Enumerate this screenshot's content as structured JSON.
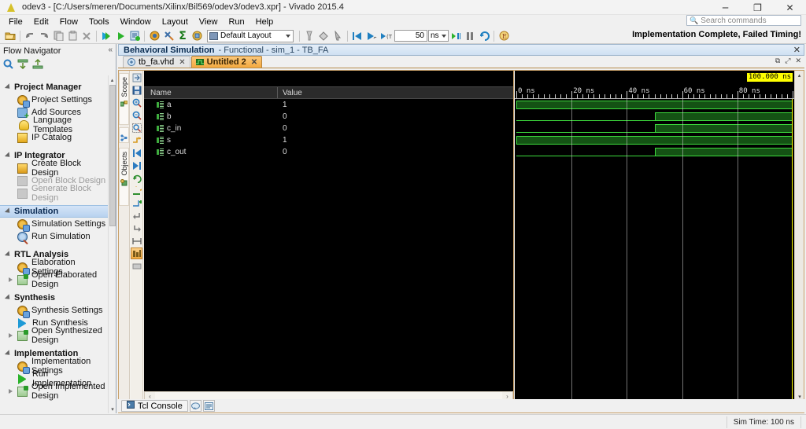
{
  "window": {
    "title": "odev3 - [C:/Users/meren/Documents/Xilinx/Bil569/odev3/odev3.xpr] - Vivado 2015.4",
    "app_icon": "vivado-triangle-icon",
    "minimize": "─",
    "maximize": "❐",
    "close": "✕"
  },
  "menubar": {
    "items": [
      {
        "label": "File"
      },
      {
        "label": "Edit"
      },
      {
        "label": "Flow"
      },
      {
        "label": "Tools"
      },
      {
        "label": "Window"
      },
      {
        "label": "Layout"
      },
      {
        "label": "View"
      },
      {
        "label": "Run"
      },
      {
        "label": "Help"
      }
    ]
  },
  "search": {
    "placeholder": "Search commands",
    "icon": "search-icon"
  },
  "toolbar": {
    "layout_value": "Default Layout",
    "sim_time_value": "50",
    "sim_time_unit": "ns",
    "status_message": "Implementation Complete, Failed Timing!",
    "buttons": [
      "open-project-icon",
      "undo-icon",
      "redo-icon",
      "copy-icon",
      "paste-icon",
      "delete-icon",
      "run-synthesis-icon",
      "run-implementation-icon",
      "generate-bitstream-icon",
      "language-templates-icon",
      "settings-icon",
      "report-icon",
      "ip-catalog-icon"
    ],
    "right_buttons": [
      "mark-icon",
      "drc-icon",
      "pointer-icon",
      "restart-sim-icon",
      "run-all-icon",
      "run-for-icon",
      "step-icon",
      "pause-icon",
      "relaunch-icon",
      "break-icon"
    ]
  },
  "flow_navigator": {
    "title": "Flow Navigator",
    "collapse_icon": "collapse-left-icon",
    "tools": [
      "search-icon",
      "collapse-all-icon",
      "expand-all-icon"
    ],
    "sections": [
      {
        "label": "Project Manager",
        "selected": false,
        "items": [
          {
            "label": "Project Settings",
            "icon": "gear-icon",
            "dim": false,
            "expandable": false
          },
          {
            "label": "Add Sources",
            "icon": "add-sources-icon",
            "dim": false,
            "expandable": false
          },
          {
            "label": "Language Templates",
            "icon": "bulb-icon",
            "dim": false,
            "expandable": false
          },
          {
            "label": "IP Catalog",
            "icon": "ip-catalog-icon",
            "dim": false,
            "expandable": false
          }
        ]
      },
      {
        "label": "IP Integrator",
        "selected": false,
        "items": [
          {
            "label": "Create Block Design",
            "icon": "block-design-icon",
            "dim": false,
            "expandable": false
          },
          {
            "label": "Open Block Design",
            "icon": "block-dim-icon",
            "dim": true,
            "expandable": false
          },
          {
            "label": "Generate Block Design",
            "icon": "block-dim-icon",
            "dim": true,
            "expandable": false
          }
        ]
      },
      {
        "label": "Simulation",
        "selected": true,
        "items": [
          {
            "label": "Simulation Settings",
            "icon": "gear-icon",
            "dim": false,
            "expandable": false
          },
          {
            "label": "Run Simulation",
            "icon": "run-sim-icon",
            "dim": false,
            "expandable": false
          }
        ]
      },
      {
        "label": "RTL Analysis",
        "selected": false,
        "items": [
          {
            "label": "Elaboration Settings",
            "icon": "gear-icon",
            "dim": false,
            "expandable": false
          },
          {
            "label": "Open Elaborated Design",
            "icon": "open-design-icon",
            "dim": false,
            "expandable": true
          }
        ]
      },
      {
        "label": "Synthesis",
        "selected": false,
        "items": [
          {
            "label": "Synthesis Settings",
            "icon": "gear-icon",
            "dim": false,
            "expandable": false
          },
          {
            "label": "Run Synthesis",
            "icon": "run-green-icon",
            "dim": false,
            "expandable": false
          },
          {
            "label": "Open Synthesized Design",
            "icon": "open-design-icon",
            "dim": false,
            "expandable": true
          }
        ]
      },
      {
        "label": "Implementation",
        "selected": false,
        "items": [
          {
            "label": "Implementation Settings",
            "icon": "gear-icon",
            "dim": false,
            "expandable": false
          },
          {
            "label": "Run Implementation",
            "icon": "run-green-icon",
            "dim": false,
            "expandable": false
          },
          {
            "label": "Open Implemented Design",
            "icon": "open-design-icon",
            "dim": false,
            "expandable": true
          }
        ]
      }
    ]
  },
  "sim_panel": {
    "header_bold": "Behavioral Simulation",
    "header_sub": "- Functional - sim_1 - TB_FA",
    "header_close": "✕",
    "tabs": [
      {
        "label": "tb_fa.vhd",
        "icon": "vhdl-file-icon",
        "active": false,
        "close": "✕"
      },
      {
        "label": "Untitled 2",
        "icon": "waveform-icon",
        "active": true,
        "close": "✕"
      }
    ],
    "window_buttons": [
      "float-icon",
      "maximize-icon",
      "close-icon"
    ],
    "vertical_tabs": [
      {
        "label": "Scope",
        "icon": "scope-icon"
      },
      {
        "label": "Objects",
        "icon": "objects-icon"
      }
    ],
    "wave_toolbar": [
      "add-divider-icon",
      "save-waveform-icon",
      "zoom-in-icon",
      "zoom-out-icon",
      "zoom-fit-icon",
      "goto-time-icon",
      "previous-transition-icon",
      "next-transition-icon",
      "restart-icon",
      "relaunch-icon",
      "add-marker-icon",
      "previous-marker-icon",
      "next-marker-icon",
      "measure-icon",
      "waveform-options-icon",
      "settings-icon"
    ]
  },
  "signal_table": {
    "columns": [
      "Name",
      "Value"
    ],
    "rows": [
      {
        "name": "a",
        "value": "1",
        "icon": "signal-icon"
      },
      {
        "name": "b",
        "value": "0",
        "icon": "signal-icon"
      },
      {
        "name": "c_in",
        "value": "0",
        "icon": "signal-icon"
      },
      {
        "name": "s",
        "value": "1",
        "icon": "signal-icon"
      },
      {
        "name": "c_out",
        "value": "0",
        "icon": "signal-icon"
      }
    ]
  },
  "waveform": {
    "cursor_label": "100.000 ns",
    "time_start_ns": 0,
    "time_end_ns": 100,
    "major_tick_step_ns": 20,
    "minor_tick_step_ns": 2,
    "tick_labels": [
      "0 ns",
      "20 ns",
      "40 ns",
      "60 ns",
      "80 ns"
    ],
    "tick_label_times": [
      0,
      20,
      40,
      60,
      80
    ],
    "gridline_times": [
      20,
      40,
      60,
      80
    ],
    "signals": [
      {
        "name": "a",
        "transitions": [
          {
            "t": 0,
            "v": 1
          }
        ]
      },
      {
        "name": "b",
        "transitions": [
          {
            "t": 0,
            "v": 0
          },
          {
            "t": 50,
            "v": 1
          }
        ]
      },
      {
        "name": "c_in",
        "transitions": [
          {
            "t": 0,
            "v": 0
          },
          {
            "t": 50,
            "v": 1
          }
        ]
      },
      {
        "name": "s",
        "transitions": [
          {
            "t": 0,
            "v": 1
          }
        ]
      },
      {
        "name": "c_out",
        "transitions": [
          {
            "t": 0,
            "v": 0
          },
          {
            "t": 50,
            "v": 1
          }
        ]
      }
    ],
    "high_fill": "#145214",
    "high_stroke": "#3ddc3d",
    "background": "#000000",
    "cursor_color": "#ffff00"
  },
  "scrollbars": {
    "left_arrow": "‹",
    "right_arrow": "›",
    "up_arrow": "▴",
    "down_arrow": "▾"
  },
  "console": {
    "tabs": [
      {
        "label": "Tcl Console",
        "icon": "console-icon"
      }
    ],
    "buttons": [
      "messages-icon",
      "log-icon"
    ]
  },
  "statusbar": {
    "sim_time": "Sim Time: 100 ns"
  }
}
